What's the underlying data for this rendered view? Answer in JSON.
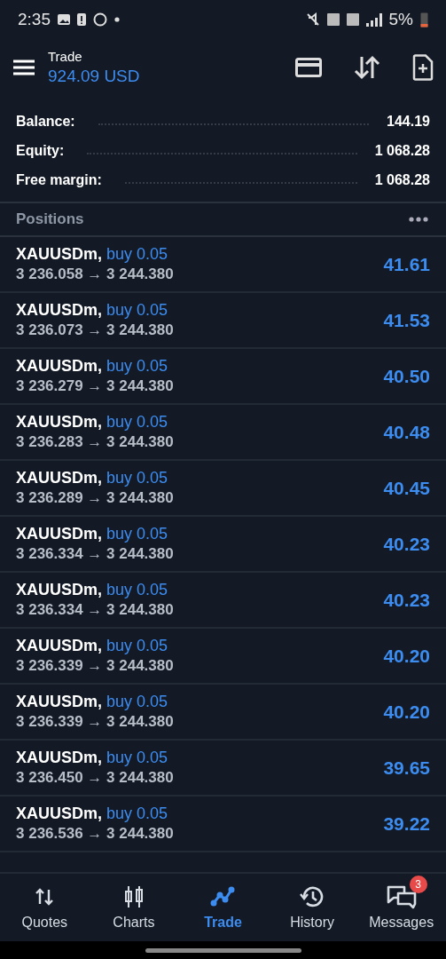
{
  "status_bar": {
    "time": "2:35",
    "battery": "5%"
  },
  "header": {
    "title": "Trade",
    "balance": "924.09 USD"
  },
  "summary": [
    {
      "label": "Balance:",
      "value": "144.19"
    },
    {
      "label": "Equity:",
      "value": "1 068.28"
    },
    {
      "label": "Free margin:",
      "value": "1 068.28"
    }
  ],
  "positions_title": "Positions",
  "positions": [
    {
      "symbol": "XAUUSDm,",
      "side": "buy 0.05",
      "prices": "3 236.058 → 3 244.380",
      "profit": "41.61"
    },
    {
      "symbol": "XAUUSDm,",
      "side": "buy 0.05",
      "prices": "3 236.073 → 3 244.380",
      "profit": "41.53"
    },
    {
      "symbol": "XAUUSDm,",
      "side": "buy 0.05",
      "prices": "3 236.279 → 3 244.380",
      "profit": "40.50"
    },
    {
      "symbol": "XAUUSDm,",
      "side": "buy 0.05",
      "prices": "3 236.283 → 3 244.380",
      "profit": "40.48"
    },
    {
      "symbol": "XAUUSDm,",
      "side": "buy 0.05",
      "prices": "3 236.289 → 3 244.380",
      "profit": "40.45"
    },
    {
      "symbol": "XAUUSDm,",
      "side": "buy 0.05",
      "prices": "3 236.334 → 3 244.380",
      "profit": "40.23"
    },
    {
      "symbol": "XAUUSDm,",
      "side": "buy 0.05",
      "prices": "3 236.334 → 3 244.380",
      "profit": "40.23"
    },
    {
      "symbol": "XAUUSDm,",
      "side": "buy 0.05",
      "prices": "3 236.339 → 3 244.380",
      "profit": "40.20"
    },
    {
      "symbol": "XAUUSDm,",
      "side": "buy 0.05",
      "prices": "3 236.339 → 3 244.380",
      "profit": "40.20"
    },
    {
      "symbol": "XAUUSDm,",
      "side": "buy 0.05",
      "prices": "3 236.450 → 3 244.380",
      "profit": "39.65"
    },
    {
      "symbol": "XAUUSDm,",
      "side": "buy 0.05",
      "prices": "3 236.536 → 3 244.380",
      "profit": "39.22"
    }
  ],
  "nav": [
    {
      "label": "Quotes",
      "selected": false
    },
    {
      "label": "Charts",
      "selected": false
    },
    {
      "label": "Trade",
      "selected": true
    },
    {
      "label": "History",
      "selected": false
    },
    {
      "label": "Messages",
      "selected": false,
      "badge": "3"
    }
  ]
}
